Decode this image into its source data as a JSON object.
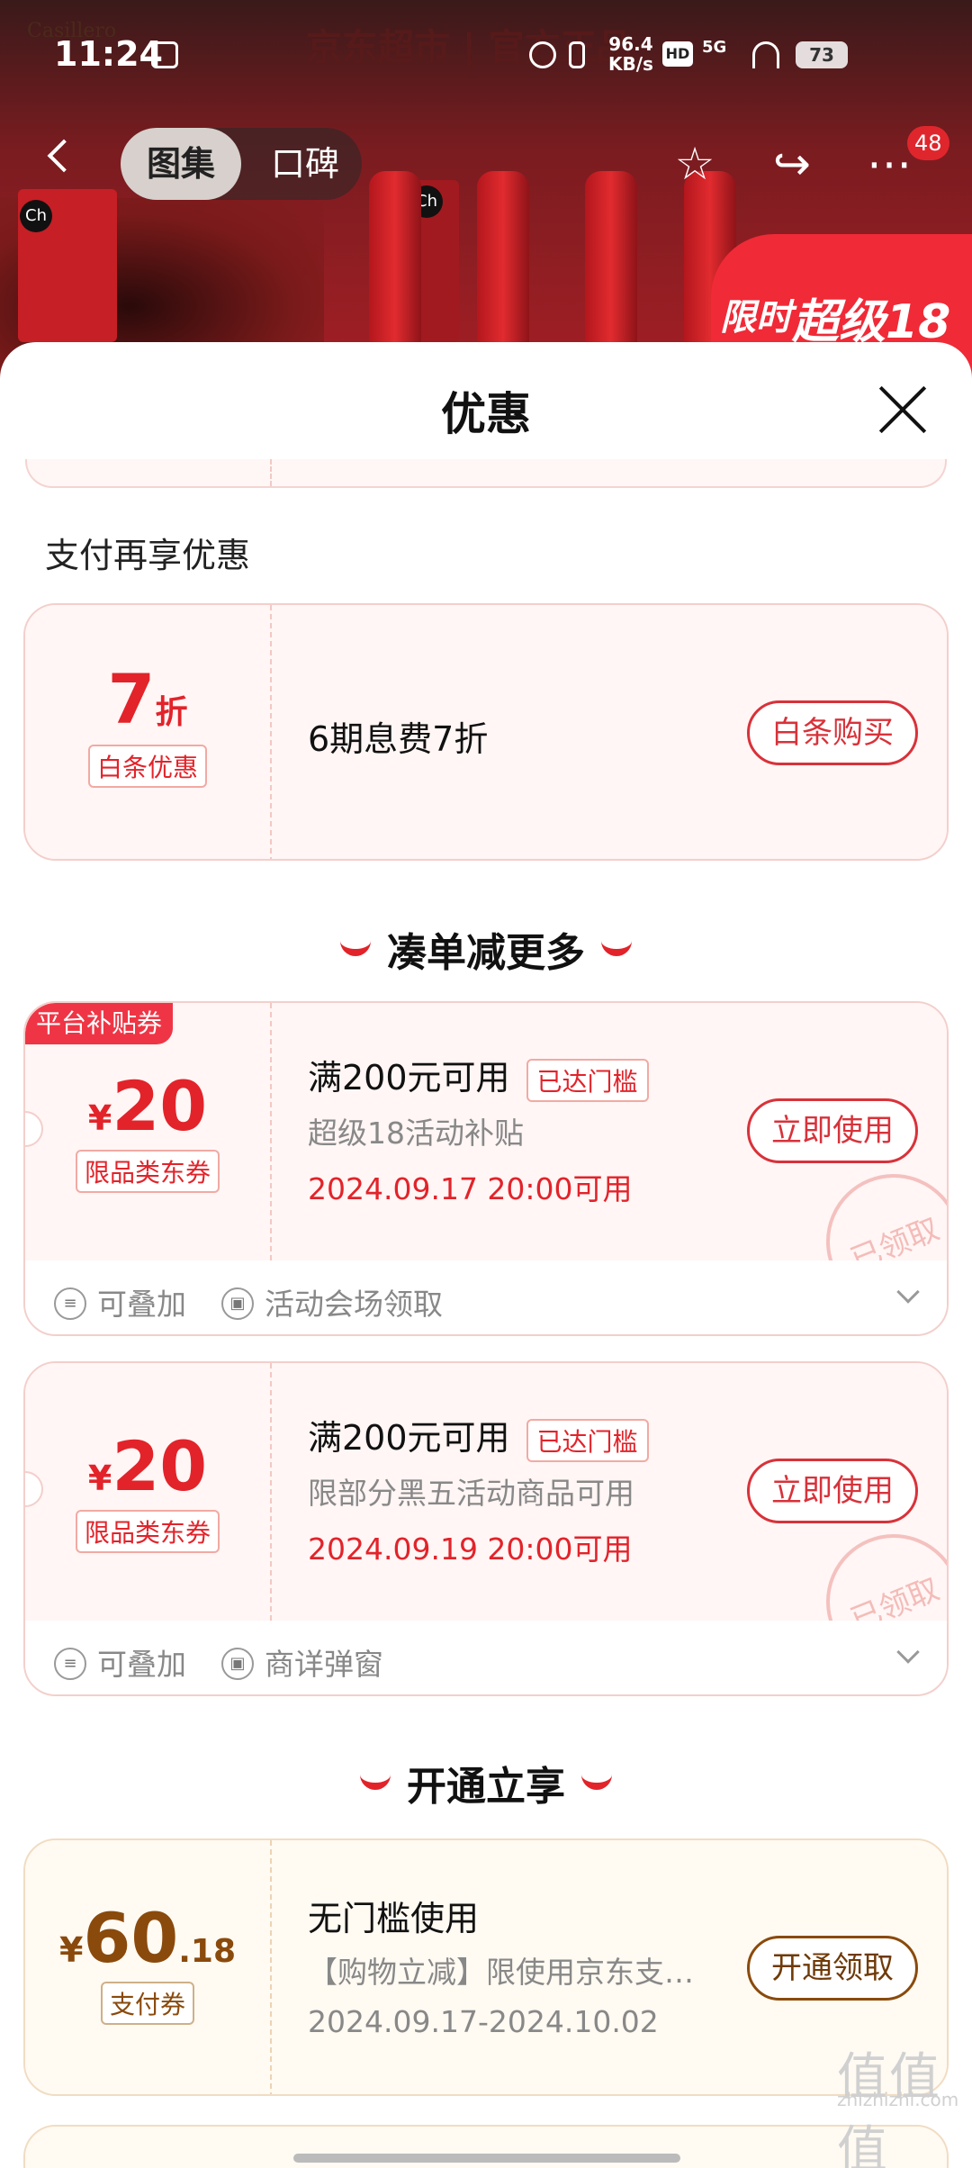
{
  "status_bar": {
    "time": "11:24",
    "net_speed_value": "96.4",
    "net_speed_unit": "KB/s",
    "hd": "HD",
    "network": "5G",
    "battery": "73"
  },
  "background": {
    "shop_title": "京东超市 | 官方正品",
    "brand_text": "Casillero",
    "promo_label": "超级18",
    "limit_label": "限时"
  },
  "nav": {
    "tabs": [
      "图集",
      "口碑"
    ],
    "badge_count": "48"
  },
  "sheet": {
    "title": "优惠",
    "pay_section_label": "支付再享优惠",
    "baitiao_card": {
      "amount": "7",
      "unit": "折",
      "tag": "白条优惠",
      "title": "6期息费7折",
      "button": "白条购买"
    },
    "combo_heading": "凑单减更多",
    "coupons": [
      {
        "corner_tag": "平台补贴券",
        "currency": "¥",
        "amount": "20",
        "tag": "限品类东券",
        "title": "满200元可用",
        "reached": "已达门槛",
        "sub": "超级18活动补贴",
        "date": "2024.09.17 20:00可用",
        "button": "立即使用",
        "stamp": "已领取",
        "foot_stack": "可叠加",
        "foot_source": "活动会场领取"
      },
      {
        "corner_tag": "",
        "currency": "¥",
        "amount": "20",
        "tag": "限品类东券",
        "title": "满200元可用",
        "reached": "已达门槛",
        "sub": "限部分黑五活动商品可用",
        "date": "2024.09.19 20:00可用",
        "button": "立即使用",
        "stamp": "已领取",
        "foot_stack": "可叠加",
        "foot_source": "商详弹窗"
      }
    ],
    "open_heading": "开通立享",
    "pay_coupon": {
      "currency": "¥",
      "amount_int": "60",
      "amount_dec": ".18",
      "tag": "支付券",
      "title": "无门槛使用",
      "sub": "【购物立减】限使用京东支…",
      "date": "2024.09.17-2024.10.02",
      "button": "开通领取"
    }
  },
  "watermark": {
    "logo": "值值值",
    "site": "zhizhizhi.com"
  }
}
